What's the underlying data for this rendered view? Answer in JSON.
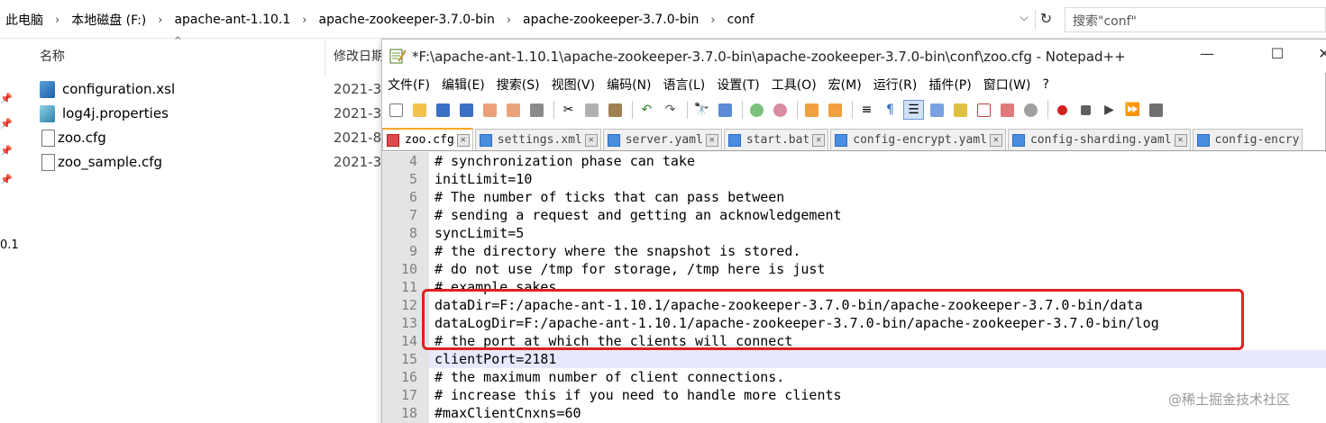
{
  "explorer": {
    "breadcrumbs": [
      "此电脑",
      "本地磁盘 (F:)",
      "apache-ant-1.10.1",
      "apache-zookeeper-3.7.0-bin",
      "apache-zookeeper-3.7.0-bin",
      "conf"
    ],
    "search_placeholder": "搜索\"conf\"",
    "nav_text": "0.1",
    "columns": {
      "name": "名称",
      "modified": "修改日期"
    },
    "files": [
      {
        "name": "configuration.xsl",
        "icon": "xsl-file-icon",
        "date": "2021-3"
      },
      {
        "name": "log4j.properties",
        "icon": "properties-file-icon",
        "date": "2021-3"
      },
      {
        "name": "zoo.cfg",
        "icon": "cfg-file-icon",
        "date": "2021-8"
      },
      {
        "name": "zoo_sample.cfg",
        "icon": "cfg-file-icon",
        "date": "2021-3"
      }
    ]
  },
  "notepad": {
    "title": "*F:\\apache-ant-1.10.1\\apache-zookeeper-3.7.0-bin\\apache-zookeeper-3.7.0-bin\\conf\\zoo.cfg - Notepad++",
    "menu": [
      "文件(F)",
      "编辑(E)",
      "搜索(S)",
      "视图(V)",
      "编码(N)",
      "语言(L)",
      "设置(T)",
      "工具(O)",
      "宏(M)",
      "运行(R)",
      "插件(P)",
      "窗口(W)",
      "?"
    ],
    "tabs": [
      {
        "label": "zoo.cfg",
        "active": true
      },
      {
        "label": "settings.xml",
        "active": false
      },
      {
        "label": "server.yaml",
        "active": false
      },
      {
        "label": "start.bat",
        "active": false
      },
      {
        "label": "config-encrypt.yaml",
        "active": false
      },
      {
        "label": "config-sharding.yaml",
        "active": false
      },
      {
        "label": "config-encry",
        "active": false
      }
    ],
    "lines": [
      {
        "n": "4",
        "text": "# synchronization phase can take"
      },
      {
        "n": "5",
        "text": "initLimit=10"
      },
      {
        "n": "6",
        "text": "# The number of ticks that can pass between"
      },
      {
        "n": "7",
        "text": "# sending a request and getting an acknowledgement"
      },
      {
        "n": "8",
        "text": "syncLimit=5"
      },
      {
        "n": "9",
        "text": "# the directory where the snapshot is stored."
      },
      {
        "n": "10",
        "text": "# do not use /tmp for storage, /tmp here is just"
      },
      {
        "n": "11",
        "text": "# example sakes."
      },
      {
        "n": "12",
        "text": "dataDir=F:/apache-ant-1.10.1/apache-zookeeper-3.7.0-bin/apache-zookeeper-3.7.0-bin/data"
      },
      {
        "n": "13",
        "text": "dataLogDir=F:/apache-ant-1.10.1/apache-zookeeper-3.7.0-bin/apache-zookeeper-3.7.0-bin/log"
      },
      {
        "n": "14",
        "text": "# the port at which the clients will connect"
      },
      {
        "n": "15",
        "text": "clientPort=2181"
      },
      {
        "n": "16",
        "text": "# the maximum number of client connections."
      },
      {
        "n": "17",
        "text": "# increase this if you need to handle more clients"
      },
      {
        "n": "18",
        "text": "#maxClientCnxns=60"
      }
    ],
    "current_line": "15"
  },
  "watermark": "@稀土掘金技术社区",
  "colors": {
    "highlight_box": "#e02020",
    "current_line_bg": "#e8e8ff",
    "tab_accent": "#f9a825"
  }
}
